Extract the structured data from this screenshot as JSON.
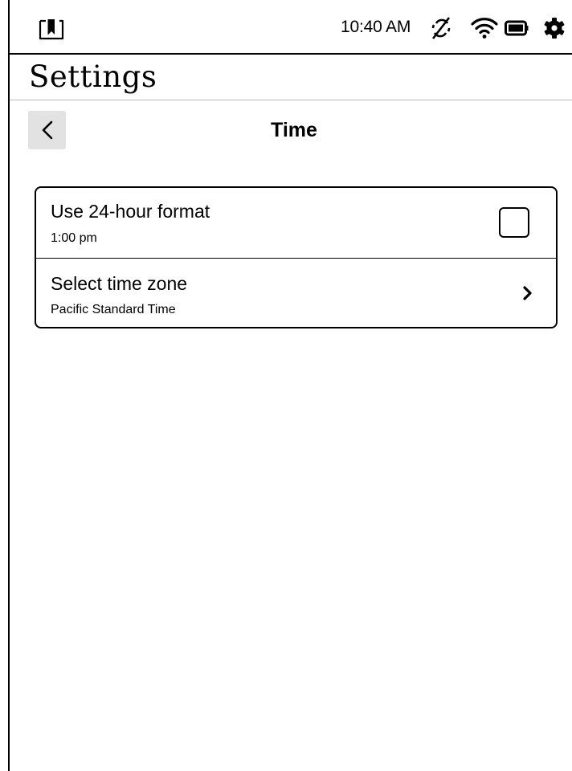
{
  "status_bar": {
    "time": "10:40 AM",
    "icons": [
      "home-book-icon",
      "sync-off-icon",
      "wifi-icon",
      "battery-icon",
      "settings-gear-icon"
    ]
  },
  "header": {
    "title": "Settings"
  },
  "subheader": {
    "back_icon": "chevron-left-icon",
    "title": "Time"
  },
  "settings": {
    "items": [
      {
        "label": "Use 24-hour format",
        "value": "1:00 pm",
        "control": "checkbox",
        "checked": false
      },
      {
        "label": "Select time zone",
        "value": "Pacific Standard Time",
        "control": "chevron-right-icon"
      }
    ]
  }
}
